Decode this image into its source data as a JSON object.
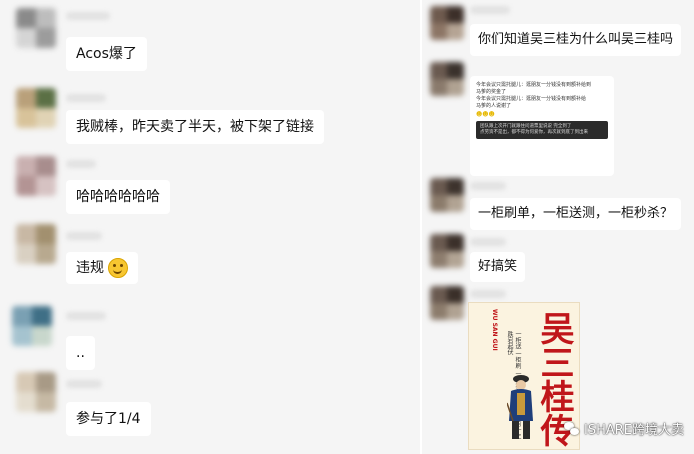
{
  "left_chat": {
    "messages": [
      {
        "text": "Acos爆了"
      },
      {
        "text": "我贼棒，昨天卖了半天，被下架了链接"
      },
      {
        "text": "哈哈哈哈哈哈"
      },
      {
        "text": "违规",
        "emoji": "smile-emoji"
      },
      {
        "text": ".."
      },
      {
        "text": "参与了1/4"
      }
    ]
  },
  "right_chat": {
    "messages": [
      {
        "text": "你们知道吴三桂为什么叫吴三桂吗"
      },
      {
        "type": "screenshot-image",
        "lines": [
          "今年会议只需托腿儿：逛朋友一分钱没有到额补给到",
          "马爹的奖金了",
          "今年会议只需托腿儿：逛朋友一分钱没有到额补给",
          "马爹的人说谢了"
        ],
        "emoji_row": "☻☻☻",
        "dark_lines": [
          "团队跟上次开门就跟住问道票里说说 完全到了",
          "点劳资不是出，都不得为何爱你，再次就到底了到出来"
        ]
      },
      {
        "text": "一柜刷单，一柜送测，一柜秒杀？"
      },
      {
        "text": "好搞笑"
      },
      {
        "type": "book-image",
        "cover_title": "吴三桂传",
        "cover_pinyin": "WU SAN GUI",
        "cover_side": "一柜送 一柜刷 一柜秒杀 亦是通人的一生跌宕起伏"
      }
    ]
  },
  "watermark": {
    "text": "ISHARE跨境大卖",
    "icon": "wechat-icon"
  }
}
